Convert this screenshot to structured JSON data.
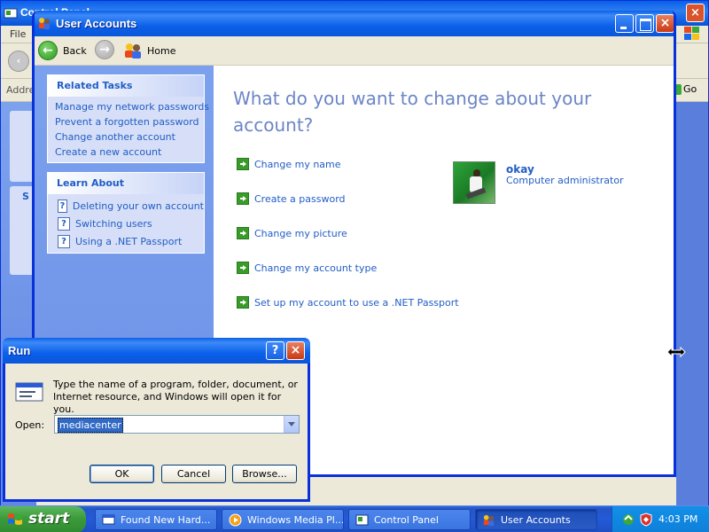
{
  "control_panel": {
    "title": "Control Panel",
    "menu_first": "File",
    "address_label": "Address",
    "go_label": "Go",
    "sidebar_letter": "S"
  },
  "user_accounts": {
    "title": "User Accounts",
    "toolbar": {
      "back": "Back",
      "home": "Home"
    },
    "related_tasks": {
      "header": "Related Tasks",
      "items": [
        "Manage my network passwords",
        "Prevent a forgotten password",
        "Change another account",
        "Create a new account"
      ]
    },
    "learn_about": {
      "header": "Learn About",
      "items": [
        "Deleting your own account",
        "Switching users",
        "Using a .NET Passport"
      ]
    },
    "heading": "What do you want to change about your account?",
    "tasks": [
      "Change my name",
      "Create a password",
      "Change my picture",
      "Change my account type",
      "Set up my account to use a .NET Passport"
    ],
    "account": {
      "name": "okay",
      "role": "Computer administrator"
    }
  },
  "run_dialog": {
    "title": "Run",
    "help_glyph": "?",
    "description": "Type the name of a program, folder, document, or Internet resource, and Windows will open it for you.",
    "open_label": "Open:",
    "open_value": "mediacenter",
    "ok": "OK",
    "cancel": "Cancel",
    "browse": "Browse..."
  },
  "taskbar": {
    "start": "start",
    "items": [
      {
        "label": "Found New Hard...",
        "icon": "hardware-icon"
      },
      {
        "label": "Windows Media Pl...",
        "icon": "media-player-icon"
      },
      {
        "label": "Control Panel",
        "icon": "control-panel-icon"
      },
      {
        "label": "User Accounts",
        "icon": "user-accounts-icon"
      }
    ],
    "clock": "4:03 PM"
  },
  "colors": {
    "xp_blue": "#0a5fe8",
    "link_blue": "#215dc6",
    "heading_blue": "#6b85c6",
    "task_pane": "#7ba1ee",
    "start_green": "#3c9a3c"
  }
}
